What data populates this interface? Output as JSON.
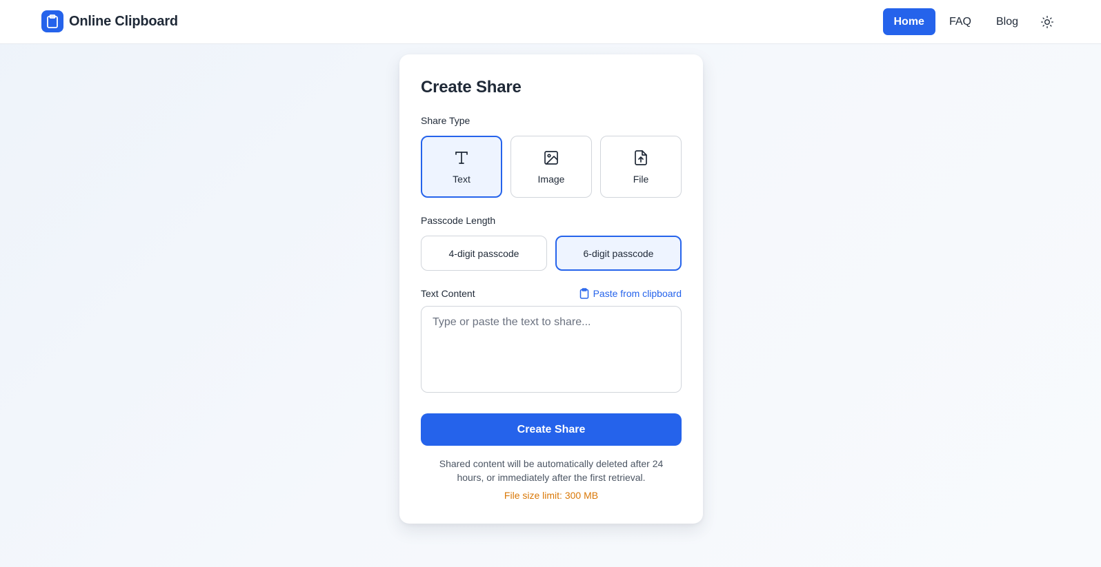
{
  "header": {
    "brand_title": "Online Clipboard",
    "brand_icon": "clipboard-icon",
    "nav": [
      {
        "label": "Home",
        "active": true
      },
      {
        "label": "FAQ",
        "active": false
      },
      {
        "label": "Blog",
        "active": false
      }
    ],
    "theme_icon": "sun-icon"
  },
  "card": {
    "title": "Create Share",
    "share_type_label": "Share Type",
    "share_types": [
      {
        "label": "Text",
        "icon": "text-icon",
        "selected": true
      },
      {
        "label": "Image",
        "icon": "image-icon",
        "selected": false
      },
      {
        "label": "File",
        "icon": "file-upload-icon",
        "selected": false
      }
    ],
    "passcode_label": "Passcode Length",
    "passcode_options": [
      {
        "label": "4-digit passcode",
        "selected": false
      },
      {
        "label": "6-digit passcode",
        "selected": true
      }
    ],
    "text_content_label": "Text Content",
    "paste_link_label": "Paste from clipboard",
    "text_value": "",
    "text_placeholder": "Type or paste the text to share...",
    "create_button_label": "Create Share",
    "note": "Shared content will be automatically deleted after 24 hours, or immediately after the first retrieval.",
    "file_size_limit": "File size limit: 300 MB"
  },
  "colors": {
    "accent": "#2563eb",
    "selected_bg": "#eef4ff",
    "warning": "#d97706"
  }
}
